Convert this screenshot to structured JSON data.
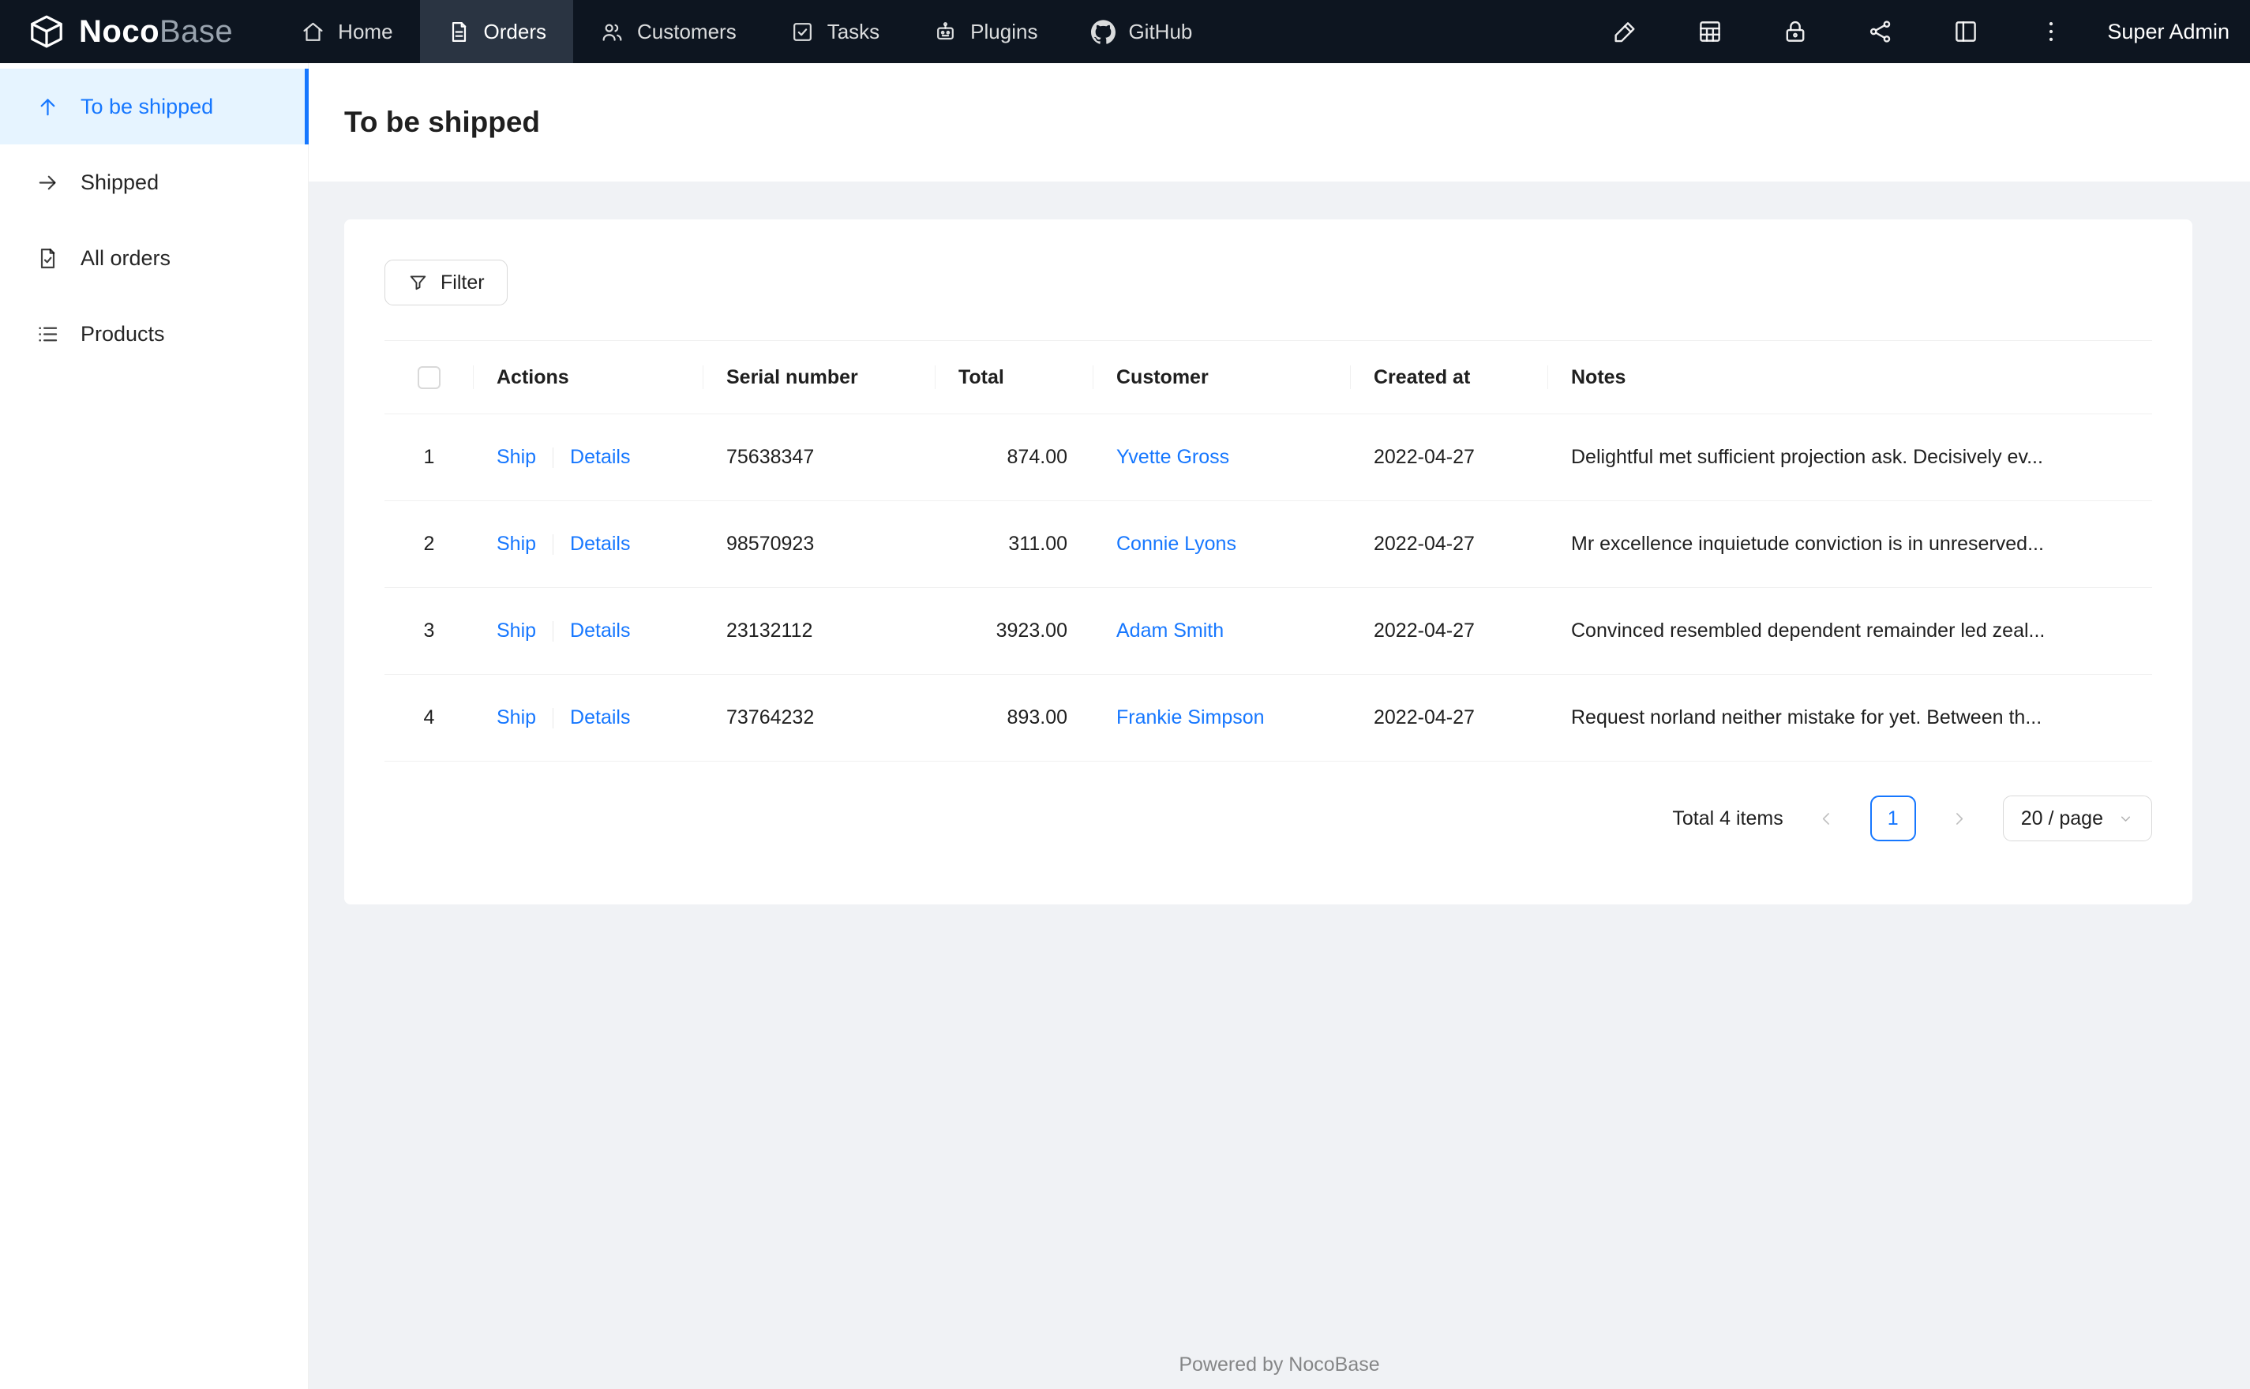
{
  "colors": {
    "accent": "#1677ff",
    "navbar_bg": "#0d1520",
    "navbar_active_bg": "#2a3442",
    "sidebar_selected_bg": "#e6f4ff"
  },
  "brand": {
    "bold": "Noco",
    "light": "Base",
    "logo_icon": "box-logo-icon"
  },
  "navbar": {
    "items": [
      {
        "label": "Home",
        "icon": "home-icon",
        "active": false
      },
      {
        "label": "Orders",
        "icon": "orders-icon",
        "active": true
      },
      {
        "label": "Customers",
        "icon": "customers-icon",
        "active": false
      },
      {
        "label": "Tasks",
        "icon": "tasks-icon",
        "active": false
      },
      {
        "label": "Plugins",
        "icon": "plugins-icon",
        "active": false
      },
      {
        "label": "GitHub",
        "icon": "github-icon",
        "active": false
      }
    ],
    "right_icons": [
      "highlighter-icon",
      "collections-icon",
      "lock-icon",
      "api-icon",
      "layout-icon",
      "more-icon"
    ],
    "user": "Super Admin"
  },
  "sidebar": {
    "items": [
      {
        "label": "To be shipped",
        "icon": "arrow-up-icon",
        "active": true
      },
      {
        "label": "Shipped",
        "icon": "arrow-right-icon",
        "active": false
      },
      {
        "label": "All orders",
        "icon": "file-check-icon",
        "active": false
      },
      {
        "label": "Products",
        "icon": "list-icon",
        "active": false
      }
    ]
  },
  "page": {
    "title": "To be shipped"
  },
  "toolbar": {
    "filter": {
      "label": "Filter",
      "icon": "filter-icon"
    }
  },
  "table": {
    "columns": [
      {
        "key": "actions",
        "label": "Actions"
      },
      {
        "key": "serial",
        "label": "Serial number"
      },
      {
        "key": "total",
        "label": "Total"
      },
      {
        "key": "customer",
        "label": "Customer"
      },
      {
        "key": "created",
        "label": "Created at"
      },
      {
        "key": "notes",
        "label": "Notes"
      }
    ],
    "rows": [
      {
        "index": "1",
        "actions": [
          "Ship",
          "Details"
        ],
        "serial": "75638347",
        "total": "874.00",
        "customer": "Yvette Gross",
        "created": "2022-04-27",
        "notes": "Delightful met sufficient projection ask. Decisively ev..."
      },
      {
        "index": "2",
        "actions": [
          "Ship",
          "Details"
        ],
        "serial": "98570923",
        "total": "311.00",
        "customer": "Connie Lyons",
        "created": "2022-04-27",
        "notes": "Mr excellence inquietude conviction is in unreserved..."
      },
      {
        "index": "3",
        "actions": [
          "Ship",
          "Details"
        ],
        "serial": "23132112",
        "total": "3923.00",
        "customer": "Adam Smith",
        "created": "2022-04-27",
        "notes": "Convinced resembled dependent remainder led zeal..."
      },
      {
        "index": "4",
        "actions": [
          "Ship",
          "Details"
        ],
        "serial": "73764232",
        "total": "893.00",
        "customer": "Frankie Simpson",
        "created": "2022-04-27",
        "notes": "Request norland neither mistake for yet. Between th..."
      }
    ]
  },
  "pagination": {
    "total_text": "Total 4 items",
    "current_page": "1",
    "page_size": "20 / page",
    "prev_icon": "chevron-left-icon",
    "next_icon": "chevron-right-icon"
  },
  "footer": {
    "text": "Powered by NocoBase"
  }
}
